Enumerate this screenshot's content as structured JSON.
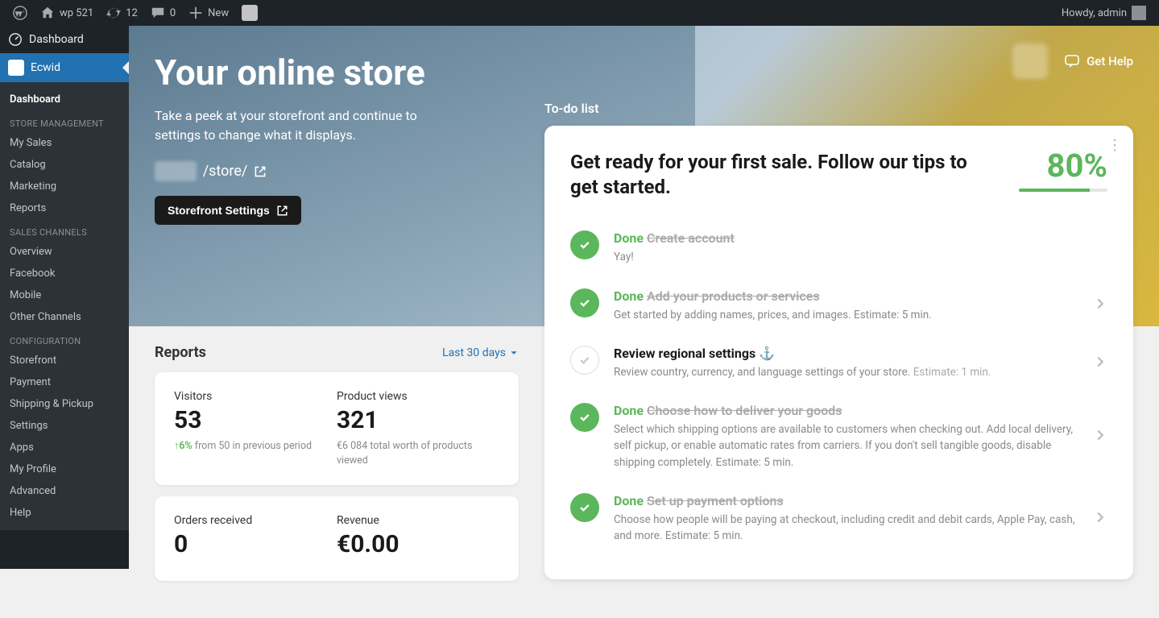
{
  "adminbar": {
    "site_name": "wp 521",
    "updates": "12",
    "comments": "0",
    "new_label": "New",
    "howdy": "Howdy, admin"
  },
  "sidebar": {
    "dashboard": "Dashboard",
    "ecwid": "Ecwid",
    "sub_dashboard": "Dashboard",
    "heading_store": "STORE MANAGEMENT",
    "my_sales": "My Sales",
    "catalog": "Catalog",
    "marketing": "Marketing",
    "reports": "Reports",
    "heading_channels": "SALES CHANNELS",
    "overview": "Overview",
    "facebook": "Facebook",
    "mobile": "Mobile",
    "other_channels": "Other Channels",
    "heading_config": "CONFIGURATION",
    "storefront": "Storefront",
    "payment": "Payment",
    "shipping": "Shipping & Pickup",
    "settings": "Settings",
    "apps": "Apps",
    "my_profile": "My Profile",
    "advanced": "Advanced",
    "help": "Help"
  },
  "hero": {
    "title": "Your online store",
    "subtitle": "Take a peek at your storefront and continue to settings to change what it displays.",
    "url_path": "/store/",
    "btn": "Storefront Settings",
    "get_help": "Get Help"
  },
  "reports": {
    "title": "Reports",
    "range": "Last 30 days",
    "visitors_label": "Visitors",
    "visitors_value": "53",
    "visitors_delta": "↑6%",
    "visitors_note": " from 50 in previous period",
    "views_label": "Product views",
    "views_value": "321",
    "views_note": "€6 084 total worth of products viewed",
    "orders_label": "Orders received",
    "orders_value": "0",
    "revenue_label": "Revenue",
    "revenue_value": "€0.00"
  },
  "todo": {
    "label": "To-do list",
    "title": "Get ready for your first sale. Follow our tips to get started.",
    "pct": "80%",
    "tasks": [
      {
        "done": true,
        "title": "Create account",
        "desc": "Yay!",
        "chev": false
      },
      {
        "done": true,
        "title": "Add your products or services",
        "desc": "Get started by adding names, prices, and images. Estimate: 5 min.",
        "chev": true
      },
      {
        "done": false,
        "title": "Review regional settings",
        "anchor": "⚓",
        "desc": "Review country, currency, and language settings of your store. ",
        "estimate": "Estimate: 1 min.",
        "chev": true
      },
      {
        "done": true,
        "title": "Choose how to deliver your goods",
        "desc": "Select which shipping options are available to customers when checking out. Add local delivery, self pickup, or enable automatic rates from carriers. If you don't sell tangible goods, disable shipping completely. Estimate: 5 min.",
        "chev": true
      },
      {
        "done": true,
        "title": "Set up payment options",
        "desc": "Choose how people will be paying at checkout, including credit and debit cards, Apple Pay, cash, and more. Estimate: 5 min.",
        "chev": true
      }
    ]
  }
}
